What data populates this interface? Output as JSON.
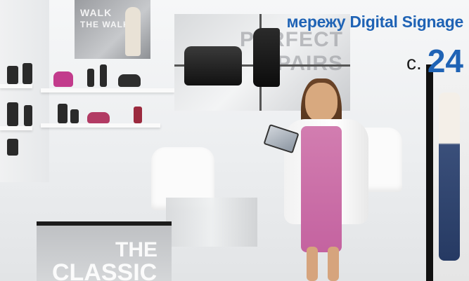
{
  "headline": {
    "line1_partial": "",
    "line2": "мережу Digital Signage"
  },
  "page_ref": {
    "prefix": "с.",
    "number": "24"
  },
  "posters": {
    "small_words": [
      "WALK",
      "THE WALK"
    ],
    "big_words": [
      "PERFECT",
      "PAIRS"
    ]
  },
  "counter_words": [
    "THE",
    "CLASSIC"
  ],
  "colors": {
    "headline_blue": "#1f63b5",
    "dress_pink": "#c463a0"
  }
}
